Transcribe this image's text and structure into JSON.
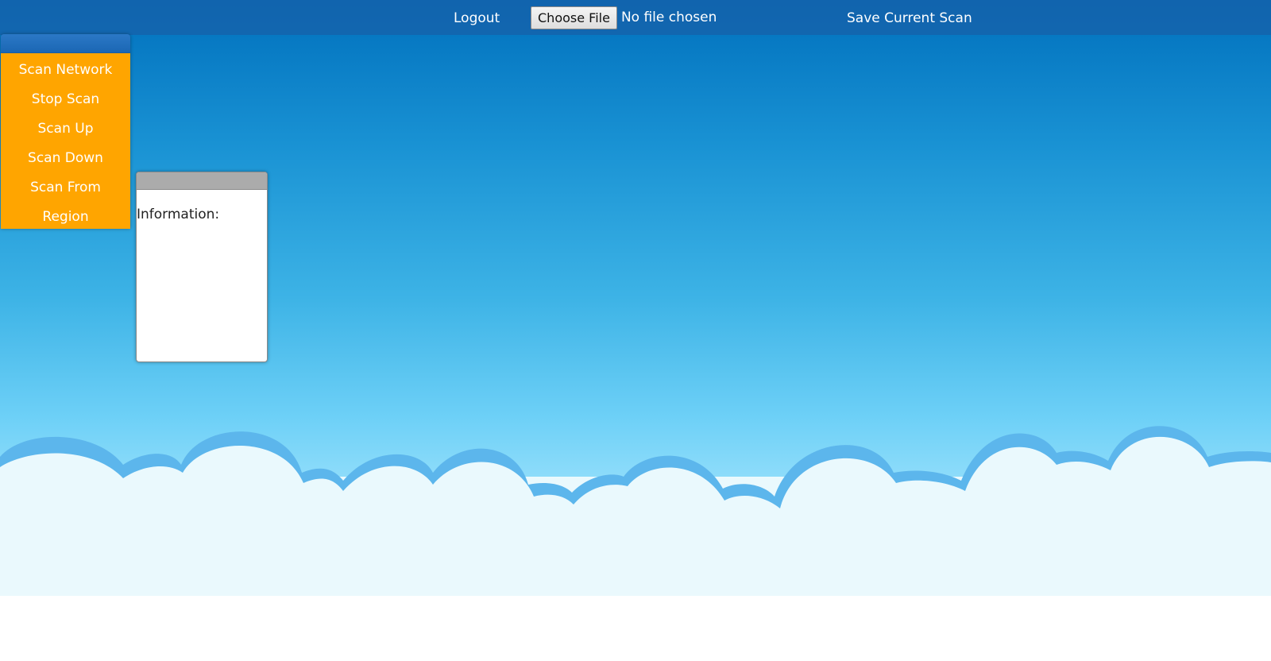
{
  "topbar": {
    "logout_label": "Logout",
    "choose_file_label": "Choose File",
    "file_status": "No file chosen",
    "save_scan_label": "Save Current Scan"
  },
  "menu": {
    "items": [
      {
        "label": "Scan Network"
      },
      {
        "label": "Stop Scan"
      },
      {
        "label": "Scan Up"
      },
      {
        "label": "Scan Down"
      },
      {
        "label": "Scan From"
      },
      {
        "label": "Region"
      }
    ]
  },
  "info_panel": {
    "label": "Information:"
  },
  "colors": {
    "menu_background": "#ffa500",
    "topbar_background": "#1860a8",
    "info_header": "#ababab",
    "sky_top": "#0070bd",
    "cloud_fill": "#eaf9fd"
  }
}
